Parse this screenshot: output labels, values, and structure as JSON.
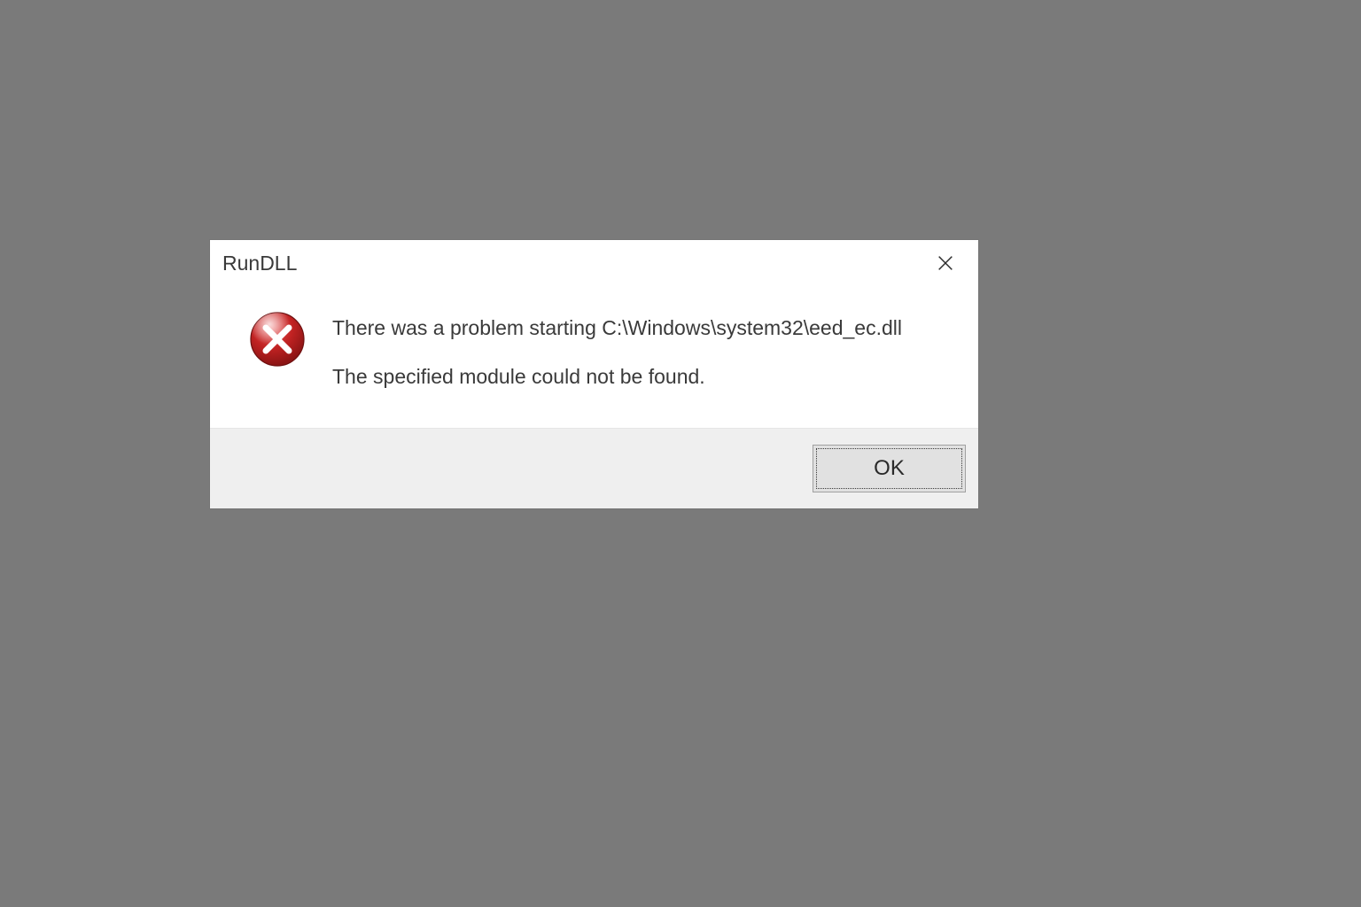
{
  "dialog": {
    "title": "RunDLL",
    "message_line1": "There was a problem starting C:\\Windows\\system32\\eed_ec.dll",
    "message_line2": "The specified module could not be found.",
    "ok_label": "OK"
  },
  "icons": {
    "close": "close-icon",
    "error": "error-icon"
  },
  "colors": {
    "background": "#7a7a7a",
    "dialog_bg": "#ffffff",
    "footer_bg": "#efefef",
    "error_red": "#b81e1e",
    "error_red_dark": "#8d1515",
    "text": "#3a3a3a"
  }
}
